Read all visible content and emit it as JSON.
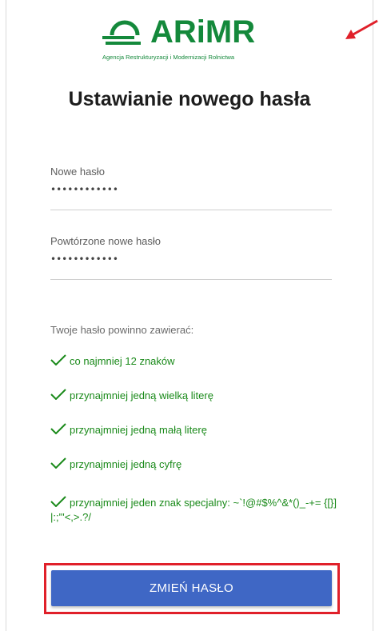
{
  "brand": {
    "name": "ARiMR",
    "subtitle": "Agencja Restrukturyzacji i Modernizacji Rolnictwa",
    "color": "#14893b",
    "logo_icon": "arimr-logo-icon"
  },
  "annotation": {
    "arrow_icon": "red-arrow-icon",
    "highlight_color": "#e0202a"
  },
  "page": {
    "title": "Ustawianie nowego hasła"
  },
  "form": {
    "new_password": {
      "label": "Nowe hasło",
      "value": "••••••••••••"
    },
    "repeat_password": {
      "label": "Powtórzone nowe hasło",
      "value": "••••••••••••"
    }
  },
  "requirements": {
    "title": "Twoje hasło powinno zawierać:",
    "items": [
      {
        "text": "co najmniej 12 znaków",
        "icon": "check-icon"
      },
      {
        "text": "przynajmniej jedną wielką literę",
        "icon": "check-icon"
      },
      {
        "text": "przynajmniej jedną małą literę",
        "icon": "check-icon"
      },
      {
        "text": "przynajmniej jedną cyfrę",
        "icon": "check-icon"
      },
      {
        "text": "przynajmniej jeden znak specjalny: ~`!@#$%^&*()_-+= {[}]|:;\"'<,>.?/",
        "icon": "check-icon"
      }
    ],
    "color": "#1a8a1a"
  },
  "submit": {
    "label": "ZMIEŃ HASŁO",
    "color": "#3f67c5"
  }
}
